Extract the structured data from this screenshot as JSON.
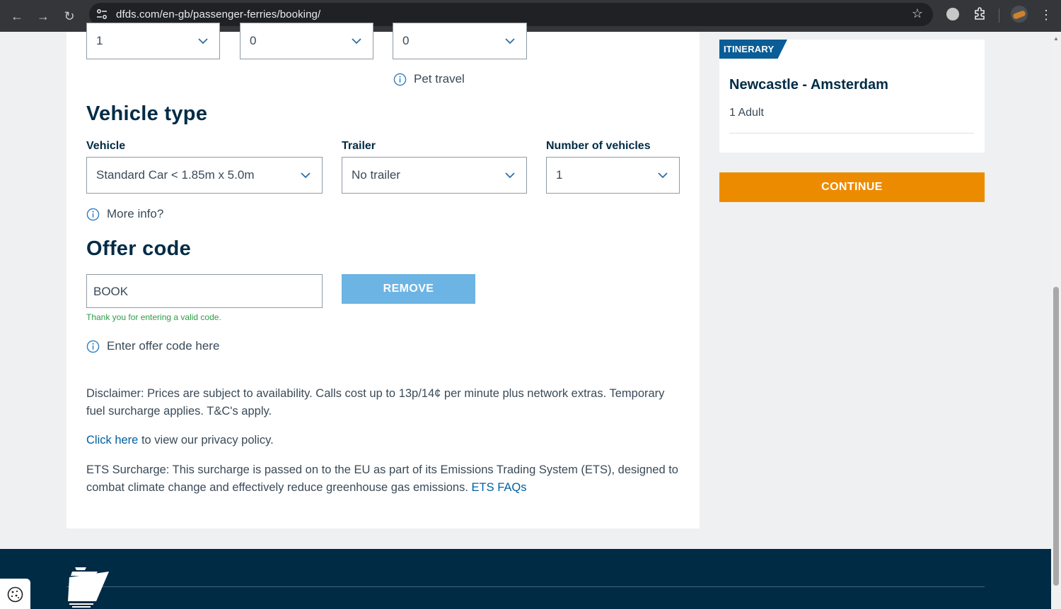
{
  "browser": {
    "url": "dfds.com/en-gb/passenger-ferries/booking/"
  },
  "passengers": {
    "selects": [
      "1",
      "0",
      "0"
    ],
    "pet_travel_label": "Pet travel"
  },
  "vehicle": {
    "heading": "Vehicle type",
    "vehicle_label": "Vehicle",
    "vehicle_value": "Standard Car < 1.85m x 5.0m",
    "trailer_label": "Trailer",
    "trailer_value": "No trailer",
    "count_label": "Number of vehicles",
    "count_value": "1",
    "more_info": "More info?"
  },
  "offer": {
    "heading": "Offer code",
    "code_value": "BOOK",
    "remove_label": "REMOVE",
    "valid_message": "Thank you for entering a valid code.",
    "hint": "Enter offer code here"
  },
  "legal": {
    "disclaimer": "Disclaimer: Prices are subject to availability. Calls cost up to 13p/14¢ per minute plus network extras. Temporary fuel surcharge applies. T&C's apply.",
    "privacy_link": "Click here",
    "privacy_rest": " to view our privacy policy.",
    "ets_text": "ETS Surcharge: This surcharge is passed on to the EU as part of its Emissions Trading System (ETS), designed to combat climate change and effectively reduce greenhouse gas emissions. ",
    "ets_link": "ETS FAQs"
  },
  "itinerary": {
    "tag": "ITINERARY",
    "route": "Newcastle - Amsterdam",
    "passengers": "1 Adult",
    "continue_label": "CONTINUE"
  },
  "colors": {
    "brand_navy": "#002b45",
    "continue_orange": "#ed8b00",
    "remove_blue": "#6cb4e4",
    "link_blue": "#0060a0",
    "valid_green": "#2e9c48"
  }
}
